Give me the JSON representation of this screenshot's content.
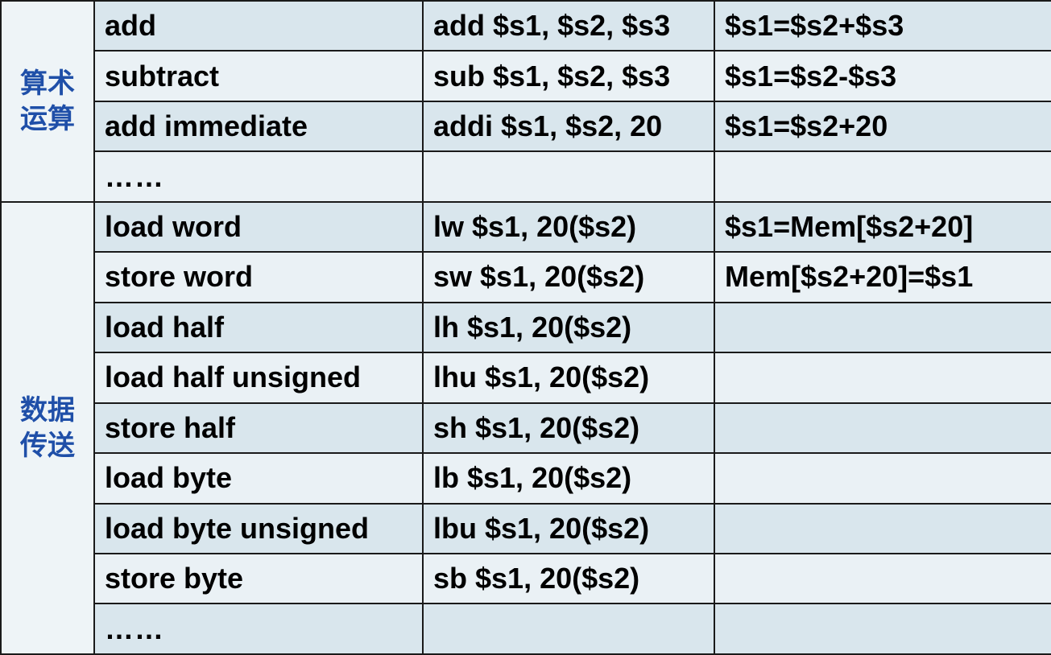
{
  "groups": {
    "arithmetic": {
      "line1": "算术",
      "line2": "运算"
    },
    "data_transfer": {
      "line1": "数据",
      "line2": "传送"
    }
  },
  "rows": [
    {
      "name": "add",
      "example": "add $s1, $s2, $s3",
      "meaning": "$s1=$s2+$s3"
    },
    {
      "name": "subtract",
      "example": "sub $s1, $s2, $s3",
      "meaning": "$s1=$s2-$s3"
    },
    {
      "name": "add immediate",
      "example": "addi $s1, $s2, 20",
      "meaning": "$s1=$s2+20"
    },
    {
      "name": "……",
      "example": "",
      "meaning": ""
    },
    {
      "name": "load word",
      "example": "lw $s1, 20($s2)",
      "meaning": "$s1=Mem[$s2+20]"
    },
    {
      "name": "store word",
      "example": "sw $s1, 20($s2)",
      "meaning": "Mem[$s2+20]=$s1"
    },
    {
      "name": "load half",
      "example": "lh $s1, 20($s2)",
      "meaning": ""
    },
    {
      "name": "load half unsigned",
      "example": "lhu $s1, 20($s2)",
      "meaning": ""
    },
    {
      "name": "store half",
      "example": "sh $s1, 20($s2)",
      "meaning": ""
    },
    {
      "name": "load byte",
      "example": "lb $s1, 20($s2)",
      "meaning": ""
    },
    {
      "name": "load byte unsigned",
      "example": "lbu $s1, 20($s2)",
      "meaning": ""
    },
    {
      "name": "store byte",
      "example": "sb $s1, 20($s2)",
      "meaning": ""
    },
    {
      "name": "……",
      "example": "",
      "meaning": ""
    }
  ],
  "colors": {
    "group_text": "#1f4fa8",
    "row_shade": "#d9e6ed",
    "row_light": "#eaf1f5",
    "border": "#1a1a1a"
  }
}
